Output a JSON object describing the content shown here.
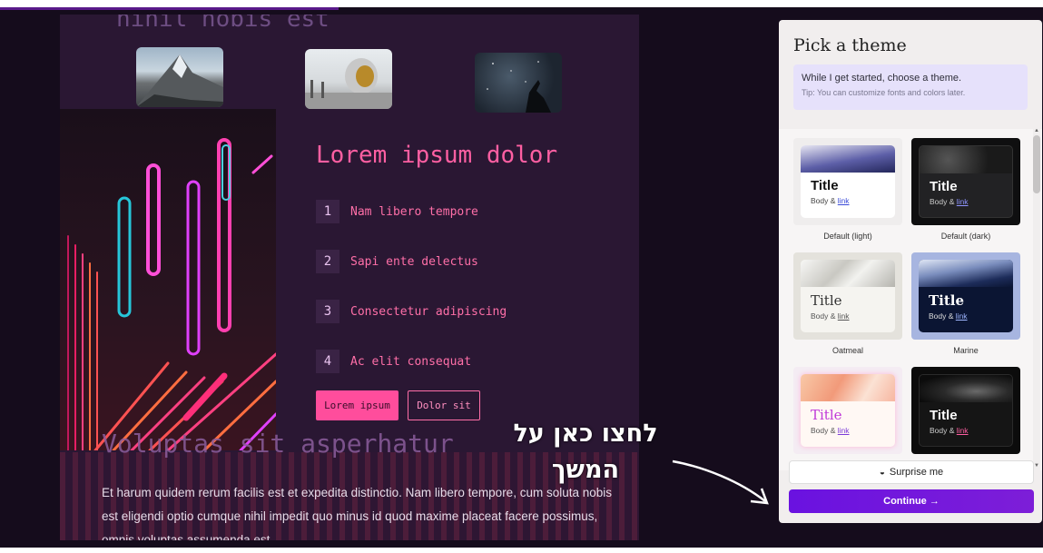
{
  "preview": {
    "ghost_title": "nihil nobis est",
    "heading": "Lorem ipsum dolor",
    "list": [
      {
        "num": "1",
        "text": "Nam libero tempore"
      },
      {
        "num": "2",
        "text": "Sapi ente delectus"
      },
      {
        "num": "3",
        "text": "Consectetur adipiscing"
      },
      {
        "num": "4",
        "text": "Ac elit consequat"
      }
    ],
    "primary_button": "Lorem ipsum",
    "outline_button": "Dolor sit",
    "ghost_heading2": "Voluptas sit asperhatur",
    "paragraph": "Et harum quidem rerum facilis est et expedita distinctio. Nam libero tempore, cum soluta nobis est eligendi optio cumque nihil impedit quo minus id quod maxime placeat facere possimus, omnis voluptas assumenda est."
  },
  "annotation": {
    "text_line1": "לחצו כאן על",
    "text_line2": "המשך"
  },
  "panel": {
    "title": "Pick a theme",
    "notice_main": "While I get started, choose a theme.",
    "notice_tip": "Tip: You can customize fonts and colors later.",
    "themes": [
      {
        "caption": "Default (light)",
        "title": "Title",
        "body": "Body &",
        "link": "link"
      },
      {
        "caption": "Default (dark)",
        "title": "Title",
        "body": "Body &",
        "link": "link"
      },
      {
        "caption": "Oatmeal",
        "title": "Title",
        "body": "Body &",
        "link": "link"
      },
      {
        "caption": "Marine",
        "title": "Title",
        "body": "Body &",
        "link": "link"
      },
      {
        "caption": "",
        "title": "Title",
        "body": "Body &",
        "link": "link"
      },
      {
        "caption": "",
        "title": "Title",
        "body": "Body &",
        "link": "link"
      }
    ],
    "surprise_label": "Surprise me",
    "continue_label": "Continue →"
  },
  "colors": {
    "accent": "#ff4d9c",
    "continue": "#6a12e0",
    "panel_bg": "#f1eeee"
  }
}
